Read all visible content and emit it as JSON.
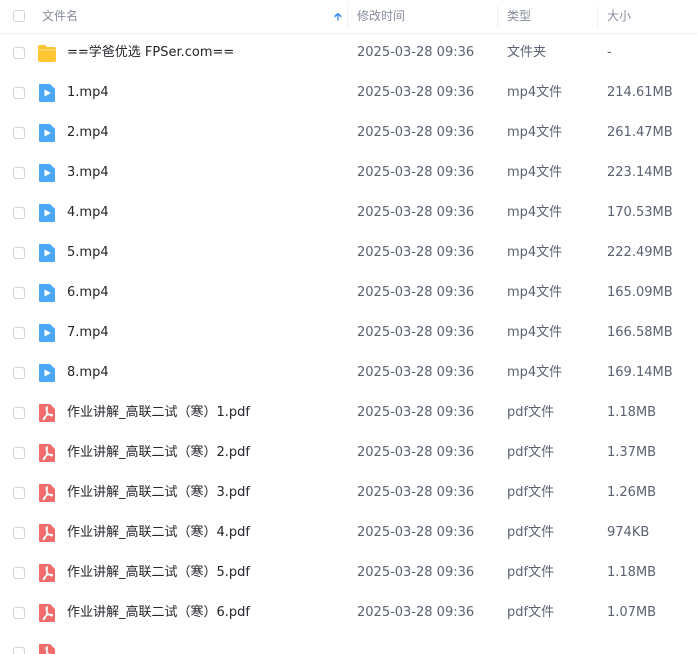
{
  "header": {
    "name": "文件名",
    "modified": "修改时间",
    "type": "类型",
    "size": "大小",
    "sort_icon": "arrow-up-icon",
    "accent_color": "#2f8cf0"
  },
  "rows": [
    {
      "name": "==学爸优选 FPSer.com==",
      "modified": "2025-03-28 09:36",
      "type": "文件夹",
      "size": "-",
      "icon": "folder-icon"
    },
    {
      "name": "1.mp4",
      "modified": "2025-03-28 09:36",
      "type": "mp4文件",
      "size": "214.61MB",
      "icon": "video-icon"
    },
    {
      "name": "2.mp4",
      "modified": "2025-03-28 09:36",
      "type": "mp4文件",
      "size": "261.47MB",
      "icon": "video-icon"
    },
    {
      "name": "3.mp4",
      "modified": "2025-03-28 09:36",
      "type": "mp4文件",
      "size": "223.14MB",
      "icon": "video-icon"
    },
    {
      "name": "4.mp4",
      "modified": "2025-03-28 09:36",
      "type": "mp4文件",
      "size": "170.53MB",
      "icon": "video-icon"
    },
    {
      "name": "5.mp4",
      "modified": "2025-03-28 09:36",
      "type": "mp4文件",
      "size": "222.49MB",
      "icon": "video-icon"
    },
    {
      "name": "6.mp4",
      "modified": "2025-03-28 09:36",
      "type": "mp4文件",
      "size": "165.09MB",
      "icon": "video-icon"
    },
    {
      "name": "7.mp4",
      "modified": "2025-03-28 09:36",
      "type": "mp4文件",
      "size": "166.58MB",
      "icon": "video-icon"
    },
    {
      "name": "8.mp4",
      "modified": "2025-03-28 09:36",
      "type": "mp4文件",
      "size": "169.14MB",
      "icon": "video-icon"
    },
    {
      "name": "作业讲解_高联二试（寒）1.pdf",
      "modified": "2025-03-28 09:36",
      "type": "pdf文件",
      "size": "1.18MB",
      "icon": "pdf-icon"
    },
    {
      "name": "作业讲解_高联二试（寒）2.pdf",
      "modified": "2025-03-28 09:36",
      "type": "pdf文件",
      "size": "1.37MB",
      "icon": "pdf-icon"
    },
    {
      "name": "作业讲解_高联二试（寒）3.pdf",
      "modified": "2025-03-28 09:36",
      "type": "pdf文件",
      "size": "1.26MB",
      "icon": "pdf-icon"
    },
    {
      "name": "作业讲解_高联二试（寒）4.pdf",
      "modified": "2025-03-28 09:36",
      "type": "pdf文件",
      "size": "974KB",
      "icon": "pdf-icon"
    },
    {
      "name": "作业讲解_高联二试（寒）5.pdf",
      "modified": "2025-03-28 09:36",
      "type": "pdf文件",
      "size": "1.18MB",
      "icon": "pdf-icon"
    },
    {
      "name": "作业讲解_高联二试（寒）6.pdf",
      "modified": "2025-03-28 09:36",
      "type": "pdf文件",
      "size": "1.07MB",
      "icon": "pdf-icon"
    },
    {
      "name": "",
      "modified": "",
      "type": "",
      "size": "",
      "icon": "pdf-icon"
    }
  ],
  "colors": {
    "folder": "#ffc533",
    "video": "#4aa8f7",
    "pdf": "#f06c6c"
  }
}
